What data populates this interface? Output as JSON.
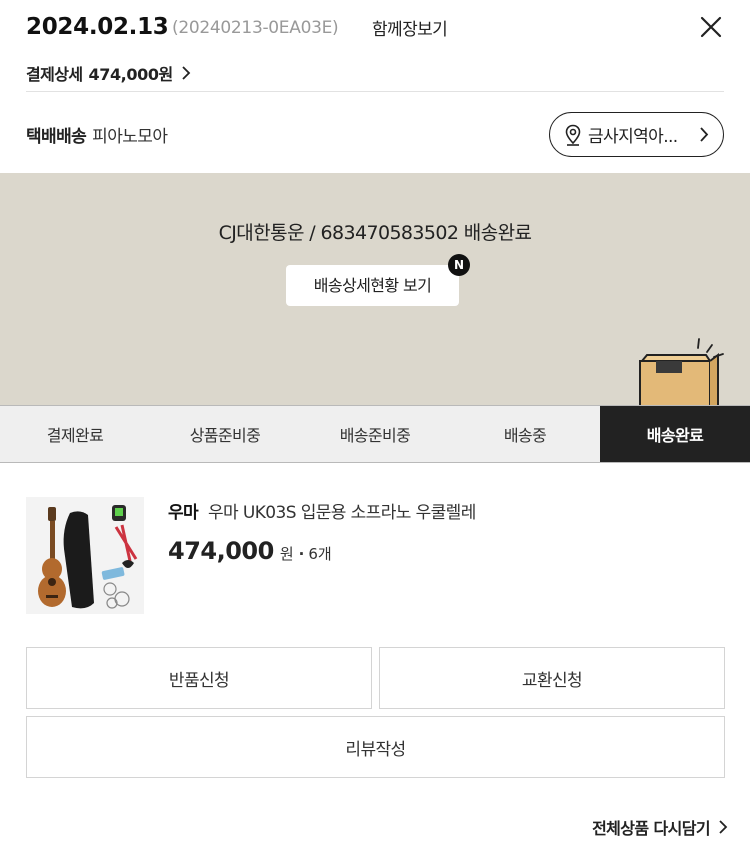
{
  "header": {
    "date": "2024.02.13",
    "order_id": "(20240213-0EA03E)",
    "together_label": "함께장보기",
    "close_icon": "close-icon"
  },
  "payment": {
    "label": "결제상세",
    "amount": "474,000원",
    "chevron_icon": "chevron-right-icon"
  },
  "delivery": {
    "type": "택배배송",
    "seller": "피아노모아",
    "region_label": "금사지역아...",
    "region_icon": "location-pin-icon"
  },
  "tracking": {
    "info": "CJ대한통운 / 683470583502 배송완료",
    "detail_button": "배송상세현황 보기",
    "badge": "N"
  },
  "steps": [
    {
      "label": "결제완료",
      "active": false
    },
    {
      "label": "상품준비중",
      "active": false
    },
    {
      "label": "배송준비중",
      "active": false
    },
    {
      "label": "배송중",
      "active": false
    },
    {
      "label": "배송완료",
      "active": true
    }
  ],
  "product": {
    "brand": "우마",
    "name": "우마 UK03S 입문용 소프라노 우쿨렐레",
    "price": "474,000",
    "currency": "원",
    "separator": "·",
    "quantity": "6개"
  },
  "actions": {
    "return": "반품신청",
    "exchange": "교환신청",
    "review": "리뷰작성"
  },
  "footer": {
    "reorder": "전체상품 다시담기"
  },
  "colors": {
    "tracking_bg": "#dbd7cc",
    "active_step_bg": "#222222",
    "box_color": "#e3b978"
  }
}
